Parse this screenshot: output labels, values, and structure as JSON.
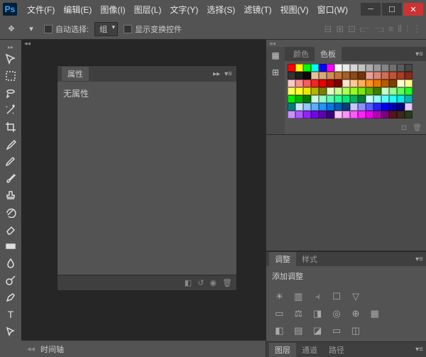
{
  "app": {
    "logo": "Ps"
  },
  "menu": [
    "文件(F)",
    "编辑(E)",
    "图像(I)",
    "图层(L)",
    "文字(Y)",
    "选择(S)",
    "滤镜(T)",
    "视图(V)",
    "窗口(W)"
  ],
  "options": {
    "auto_select": "自动选择:",
    "group": "组",
    "show_transform": "显示变换控件"
  },
  "properties": {
    "tab": "属性",
    "body": "无属性"
  },
  "timeline": {
    "label": "时间轴"
  },
  "color": {
    "tab_color": "颜色",
    "tab_swatch": "色板",
    "swatches": [
      "#ff0000",
      "#ffff00",
      "#00ff00",
      "#00ffff",
      "#0000ff",
      "#ff00ff",
      "#ffffff",
      "#ebebeb",
      "#d6d6d6",
      "#c2c2c2",
      "#adadad",
      "#999999",
      "#858585",
      "#707070",
      "#5c5c5c",
      "#474747",
      "#333333",
      "#1f1f1f",
      "#0a0a0a",
      "#e8c19a",
      "#dca778",
      "#d18d56",
      "#c37335",
      "#a85e26",
      "#8d4a18",
      "#72360a",
      "#e8a19a",
      "#dc8778",
      "#d16d56",
      "#c35335",
      "#a83e26",
      "#8d2a18",
      "#ffc8c8",
      "#ff9191",
      "#ff5a5a",
      "#ff2323",
      "#eb0000",
      "#b40000",
      "#7d0000",
      "#ffe4c8",
      "#ffc991",
      "#ffae5a",
      "#ff9323",
      "#eb7800",
      "#b45c00",
      "#7d4000",
      "#ffffc8",
      "#ffff91",
      "#ffff5a",
      "#ffff23",
      "#ebeb00",
      "#b4b400",
      "#7d7d00",
      "#e4ffc8",
      "#c9ff91",
      "#aeff5a",
      "#93ff23",
      "#78eb00",
      "#5cb400",
      "#407d00",
      "#c8ffc8",
      "#91ff91",
      "#5aff5a",
      "#23ff23",
      "#00eb00",
      "#00b400",
      "#007d00",
      "#c8ffe4",
      "#91ffc9",
      "#5affae",
      "#23ff93",
      "#00eb78",
      "#00b45c",
      "#007d40",
      "#c8ffff",
      "#91ffff",
      "#5affff",
      "#23ffff",
      "#00ebeb",
      "#00b4b4",
      "#007d7d",
      "#c8e4ff",
      "#91c9ff",
      "#5aaeff",
      "#2393ff",
      "#0078eb",
      "#005cb4",
      "#00407d",
      "#c8c8ff",
      "#9191ff",
      "#5a5aff",
      "#2323ff",
      "#0000eb",
      "#0000b4",
      "#00007d",
      "#e4c8ff",
      "#c991ff",
      "#ae5aff",
      "#9323ff",
      "#7800eb",
      "#5c00b4",
      "#40007d",
      "#ffc8ff",
      "#ff91ff",
      "#ff5aff",
      "#ff23ff",
      "#eb00eb",
      "#b400b4",
      "#7d007d",
      "#581414",
      "#3a2a1a",
      "#2a3a1a"
    ]
  },
  "adjustments": {
    "tab_adjust": "调整",
    "tab_styles": "样式",
    "label": "添加调整"
  },
  "layers": {
    "tab_layers": "图层",
    "tab_channels": "通道",
    "tab_paths": "路径"
  }
}
